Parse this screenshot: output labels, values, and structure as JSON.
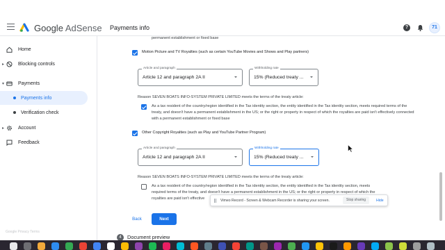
{
  "header": {
    "brand_google": "Google",
    "brand_product": "AdSense",
    "page_title": "Payments info",
    "help_glyph": "?",
    "avatar_initials": "71",
    "colors": {
      "logo_yellow": "#fbbc04",
      "logo_blue": "#1a73e8",
      "logo_green": "#34a853"
    }
  },
  "sidebar": {
    "items": [
      {
        "label": "Home",
        "icon": "home-icon"
      },
      {
        "label": "Blocking controls",
        "icon": "block-icon"
      },
      {
        "label": "Payments",
        "icon": "payments-icon"
      },
      {
        "label": "Payments info",
        "icon": "dot"
      },
      {
        "label": "Verification check",
        "icon": "dot"
      },
      {
        "label": "Account",
        "icon": "gear-icon"
      },
      {
        "label": "Feedback",
        "icon": "feedback-icon"
      }
    ],
    "footer": "Google  Privacy  Terms"
  },
  "form": {
    "prev_text_tail": "permanent establishment or fixed base",
    "motion": {
      "label": "Motion Picture and TV Royalties (such as certain YouTube Movies and Shows and Play partners)",
      "checked": true,
      "article_label": "Article and paragraph",
      "article_value": "Article 12 and paragraph 2A II",
      "rate_label": "Withholding rate",
      "rate_value": "15% (Reduced treaty ...",
      "reason": "Reason SEVEN BOATS INFO-SYSTEM PRIVATE LIMITED meets the terms of the treaty article:",
      "condition_checked": true,
      "condition": "As a tax resident of the country/region identified in the Tax identity section, the entity identified in the Tax identity section, meets required terms of the treaty, and doesn't have a permanent establishment in the US; or the right or property in respect of which the royalties are paid isn't effectively connected with a permanent establishment or fixed base"
    },
    "copyright": {
      "label": "Other Copyright Royalties (such as Play and YouTube Partner Program)",
      "checked": true,
      "article_label": "Article and paragraph",
      "article_value": "Article 12 and paragraph 2A II",
      "rate_label": "Withholding rate",
      "rate_value": "15% (Reduced treaty ...",
      "reason": "Reason SEVEN BOATS INFO-SYSTEM PRIVATE LIMITED meets the terms of the treaty article:",
      "condition_checked": false,
      "condition_line1": "As a tax resident of the country/region identified in the Tax identity section, the entity identified in the Tax identity section, meets",
      "condition_line2": "required terms of the treaty, and doesn't have a permanent establishment in the US; or the right or property in respect of which the",
      "condition_line3": "royalties are paid isn't effective"
    },
    "back_label": "Back",
    "next_label": "Next",
    "step_number": "4",
    "step_label": "Document preview"
  },
  "share_bar": {
    "message": "Vimeo Record - Screen & Webcam Recorder is sharing your screen.",
    "stop_label": "Stop sharing",
    "hide_label": "Hide"
  }
}
